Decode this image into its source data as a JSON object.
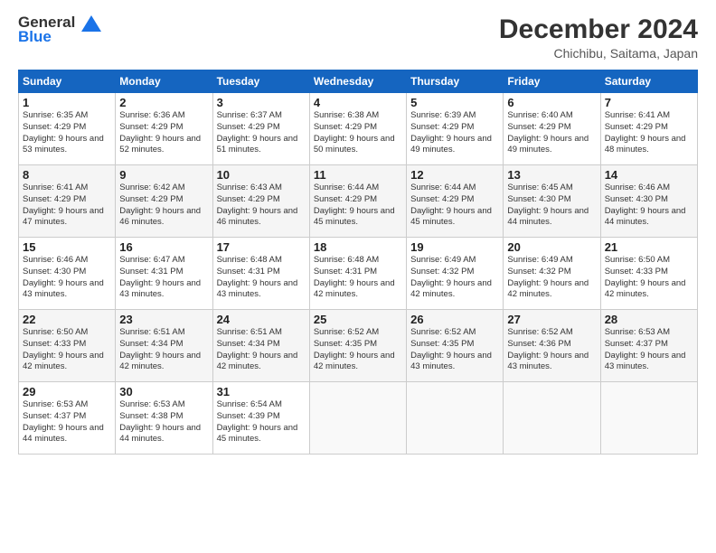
{
  "logo": {
    "line1": "General",
    "line2": "Blue"
  },
  "title": "December 2024",
  "subtitle": "Chichibu, Saitama, Japan",
  "days_header": [
    "Sunday",
    "Monday",
    "Tuesday",
    "Wednesday",
    "Thursday",
    "Friday",
    "Saturday"
  ],
  "weeks": [
    [
      {
        "num": "1",
        "rise": "6:35 AM",
        "set": "4:29 PM",
        "daylight": "9 hours and 53 minutes."
      },
      {
        "num": "2",
        "rise": "6:36 AM",
        "set": "4:29 PM",
        "daylight": "9 hours and 52 minutes."
      },
      {
        "num": "3",
        "rise": "6:37 AM",
        "set": "4:29 PM",
        "daylight": "9 hours and 51 minutes."
      },
      {
        "num": "4",
        "rise": "6:38 AM",
        "set": "4:29 PM",
        "daylight": "9 hours and 50 minutes."
      },
      {
        "num": "5",
        "rise": "6:39 AM",
        "set": "4:29 PM",
        "daylight": "9 hours and 49 minutes."
      },
      {
        "num": "6",
        "rise": "6:40 AM",
        "set": "4:29 PM",
        "daylight": "9 hours and 49 minutes."
      },
      {
        "num": "7",
        "rise": "6:41 AM",
        "set": "4:29 PM",
        "daylight": "9 hours and 48 minutes."
      }
    ],
    [
      {
        "num": "8",
        "rise": "6:41 AM",
        "set": "4:29 PM",
        "daylight": "9 hours and 47 minutes."
      },
      {
        "num": "9",
        "rise": "6:42 AM",
        "set": "4:29 PM",
        "daylight": "9 hours and 46 minutes."
      },
      {
        "num": "10",
        "rise": "6:43 AM",
        "set": "4:29 PM",
        "daylight": "9 hours and 46 minutes."
      },
      {
        "num": "11",
        "rise": "6:44 AM",
        "set": "4:29 PM",
        "daylight": "9 hours and 45 minutes."
      },
      {
        "num": "12",
        "rise": "6:44 AM",
        "set": "4:29 PM",
        "daylight": "9 hours and 45 minutes."
      },
      {
        "num": "13",
        "rise": "6:45 AM",
        "set": "4:30 PM",
        "daylight": "9 hours and 44 minutes."
      },
      {
        "num": "14",
        "rise": "6:46 AM",
        "set": "4:30 PM",
        "daylight": "9 hours and 44 minutes."
      }
    ],
    [
      {
        "num": "15",
        "rise": "6:46 AM",
        "set": "4:30 PM",
        "daylight": "9 hours and 43 minutes."
      },
      {
        "num": "16",
        "rise": "6:47 AM",
        "set": "4:31 PM",
        "daylight": "9 hours and 43 minutes."
      },
      {
        "num": "17",
        "rise": "6:48 AM",
        "set": "4:31 PM",
        "daylight": "9 hours and 43 minutes."
      },
      {
        "num": "18",
        "rise": "6:48 AM",
        "set": "4:31 PM",
        "daylight": "9 hours and 42 minutes."
      },
      {
        "num": "19",
        "rise": "6:49 AM",
        "set": "4:32 PM",
        "daylight": "9 hours and 42 minutes."
      },
      {
        "num": "20",
        "rise": "6:49 AM",
        "set": "4:32 PM",
        "daylight": "9 hours and 42 minutes."
      },
      {
        "num": "21",
        "rise": "6:50 AM",
        "set": "4:33 PM",
        "daylight": "9 hours and 42 minutes."
      }
    ],
    [
      {
        "num": "22",
        "rise": "6:50 AM",
        "set": "4:33 PM",
        "daylight": "9 hours and 42 minutes."
      },
      {
        "num": "23",
        "rise": "6:51 AM",
        "set": "4:34 PM",
        "daylight": "9 hours and 42 minutes."
      },
      {
        "num": "24",
        "rise": "6:51 AM",
        "set": "4:34 PM",
        "daylight": "9 hours and 42 minutes."
      },
      {
        "num": "25",
        "rise": "6:52 AM",
        "set": "4:35 PM",
        "daylight": "9 hours and 42 minutes."
      },
      {
        "num": "26",
        "rise": "6:52 AM",
        "set": "4:35 PM",
        "daylight": "9 hours and 43 minutes."
      },
      {
        "num": "27",
        "rise": "6:52 AM",
        "set": "4:36 PM",
        "daylight": "9 hours and 43 minutes."
      },
      {
        "num": "28",
        "rise": "6:53 AM",
        "set": "4:37 PM",
        "daylight": "9 hours and 43 minutes."
      }
    ],
    [
      {
        "num": "29",
        "rise": "6:53 AM",
        "set": "4:37 PM",
        "daylight": "9 hours and 44 minutes."
      },
      {
        "num": "30",
        "rise": "6:53 AM",
        "set": "4:38 PM",
        "daylight": "9 hours and 44 minutes."
      },
      {
        "num": "31",
        "rise": "6:54 AM",
        "set": "4:39 PM",
        "daylight": "9 hours and 45 minutes."
      },
      null,
      null,
      null,
      null
    ]
  ]
}
